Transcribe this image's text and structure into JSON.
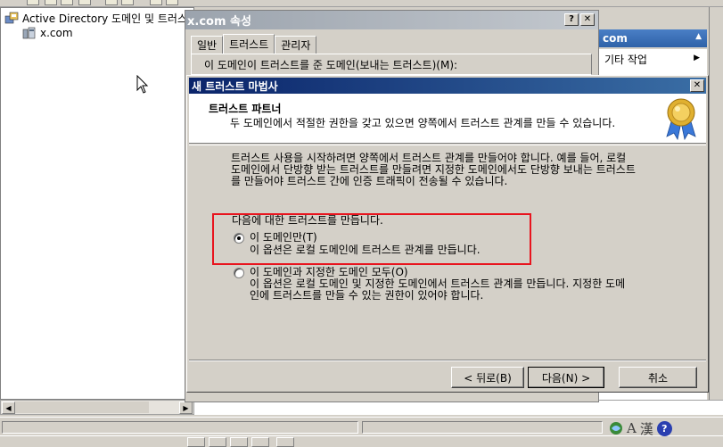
{
  "mmc": {
    "tree_root": "Active Directory 도메인 및 트러스트",
    "tree_child": "x.com",
    "actions_header": "com",
    "actions_item": "기타 작업"
  },
  "props_dialog": {
    "title": "x.com 속성",
    "tabs": [
      "일반",
      "트러스트",
      "관리자"
    ],
    "content_label": "이 도메인이 트러스트를 준 도메인(보내는 트러스트)(M):"
  },
  "wizard": {
    "title": "새 트러스트 마법사",
    "header_title": "트러스트 파트너",
    "header_subtitle": "두 도메인에서 적절한 권한을 갖고 있으면 양쪽에서 트러스트 관계를 만들 수 있습니다.",
    "intro_lines": [
      "트러스트 사용을 시작하려면 양쪽에서 트러스트 관계를 만들어야 합니다. 예를 들어, 로컬",
      "도메인에서 단방향 받는 트러스트를 만들려면 지정한 도메인에서도 단방향 보내는 트러스트",
      "를 만들어야 트러스트 간에 인증 트래픽이 전송될 수 있습니다."
    ],
    "question": "다음에 대한 트러스트를 만듭니다.",
    "options": [
      {
        "label": "이 도메인만(T)",
        "description_lines": [
          "이 옵션은 로컬 도메인에 트러스트 관계를 만듭니다."
        ],
        "checked": true
      },
      {
        "label": "이 도메인과 지정한 도메인 모두(O)",
        "description_lines": [
          "이 옵션은 로컬 도메인 및 지정한 도메인에서 트러스트 관계를 만듭니다. 지정한 도메",
          "인에 트러스트를 만들 수 있는 권한이 있어야 합니다."
        ],
        "checked": false
      }
    ],
    "buttons": {
      "back": "< 뒤로(B)",
      "next": "다음(N) >",
      "cancel": "취소"
    }
  },
  "ime": {
    "mode": "A",
    "hanja": "漢",
    "help": "?"
  },
  "colors": {
    "highlight": "#e8141e",
    "wizard_title": "#0a246a",
    "actions_header": "#2f62a8"
  }
}
